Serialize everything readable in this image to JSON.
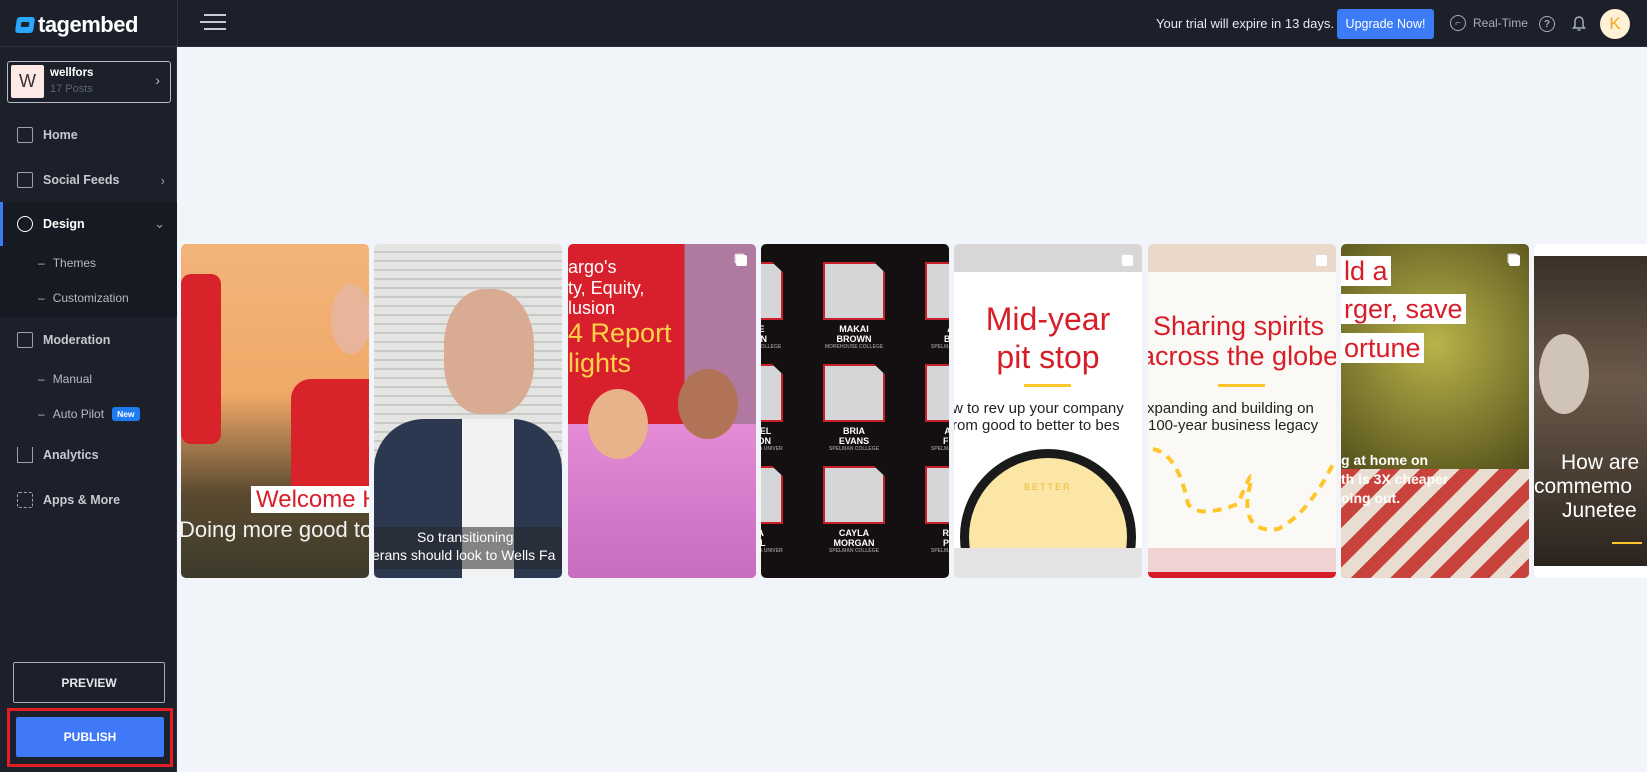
{
  "app": {
    "logo": "tagembed"
  },
  "header": {
    "trial_text": "Your trial will expire in 13 days.",
    "upgrade_label": "Upgrade Now!",
    "realtime_label": "Real-Time",
    "avatar_letter": "K"
  },
  "profile": {
    "initial": "W",
    "name": "wellfors",
    "posts": "17 Posts"
  },
  "sidebar": {
    "items": [
      {
        "label": "Home",
        "icon": "home-icon"
      },
      {
        "label": "Social Feeds",
        "icon": "add-feed-icon"
      },
      {
        "label": "Design",
        "icon": "drop-icon"
      },
      {
        "label": "Moderation",
        "icon": "moderation-icon"
      },
      {
        "label": "Analytics",
        "icon": "analytics-icon"
      },
      {
        "label": "Apps & More",
        "icon": "apps-icon"
      }
    ],
    "design_sub": [
      "Themes",
      "Customization"
    ],
    "moderation_sub": [
      "Manual",
      "Auto Pilot"
    ],
    "new_badge": "New",
    "preview_label": "PREVIEW",
    "publish_label": "PUBLISH"
  },
  "colors": {
    "accent": "#3b7bf6",
    "brand_red": "#d71e28",
    "highlight": "#e31e24"
  },
  "posts": [
    {
      "title": "Welcome H",
      "subtitle": "Doing more good tog"
    },
    {
      "caption_1": "So transitioning",
      "caption_2": "erans should look to Wells Fa"
    },
    {
      "line1": "argo's",
      "line2": "ty, Equity,",
      "line3": "lusion",
      "line4": "4 Report",
      "line5": "lights"
    },
    {
      "people": [
        [
          "RECE",
          "ALLEN",
          "MOREHOUSE COLLEGE"
        ],
        [
          "MAKAI",
          "BROWN",
          "MOREHOUSE COLLEGE"
        ],
        [
          "AVE",
          "BUTL",
          "SPELMAN COLLEGE"
        ],
        [
          "MANUEL",
          "ALDSON",
          "CLARK ATLANTA UNIVERSITY"
        ],
        [
          "BRIA",
          "EVANS",
          "SPELMAN COLLEGE"
        ],
        [
          "ALYS",
          "FURM",
          "SPELMAN COLLEGE"
        ],
        [
          "AYLA",
          "CNEIL",
          "CLARK ATLANTA UNIVERSITY"
        ],
        [
          "CAYLA",
          "MORGAN",
          "SPELMAN COLLEGE"
        ],
        [
          "RHAM",
          "PHILL",
          "SPELMAN COLLEGE"
        ]
      ]
    },
    {
      "title1": "Mid-year",
      "title2": "pit stop",
      "body1": "w to rev up your company",
      "body2": "rom good to better to bes",
      "dial": "BETTER"
    },
    {
      "title1": "Sharing spirits",
      "title2": "across the globe",
      "body1": "xpanding and building on",
      "body2": "100-year business legacy"
    },
    {
      "title1": "ld a",
      "title2": "rger, save",
      "title3": "ortune",
      "body1": "g at home on",
      "body2": "th is 3X cheaper",
      "body3": "oing out."
    },
    {
      "line1": "How are",
      "line2": "commemo",
      "line3": "Junetee"
    }
  ]
}
